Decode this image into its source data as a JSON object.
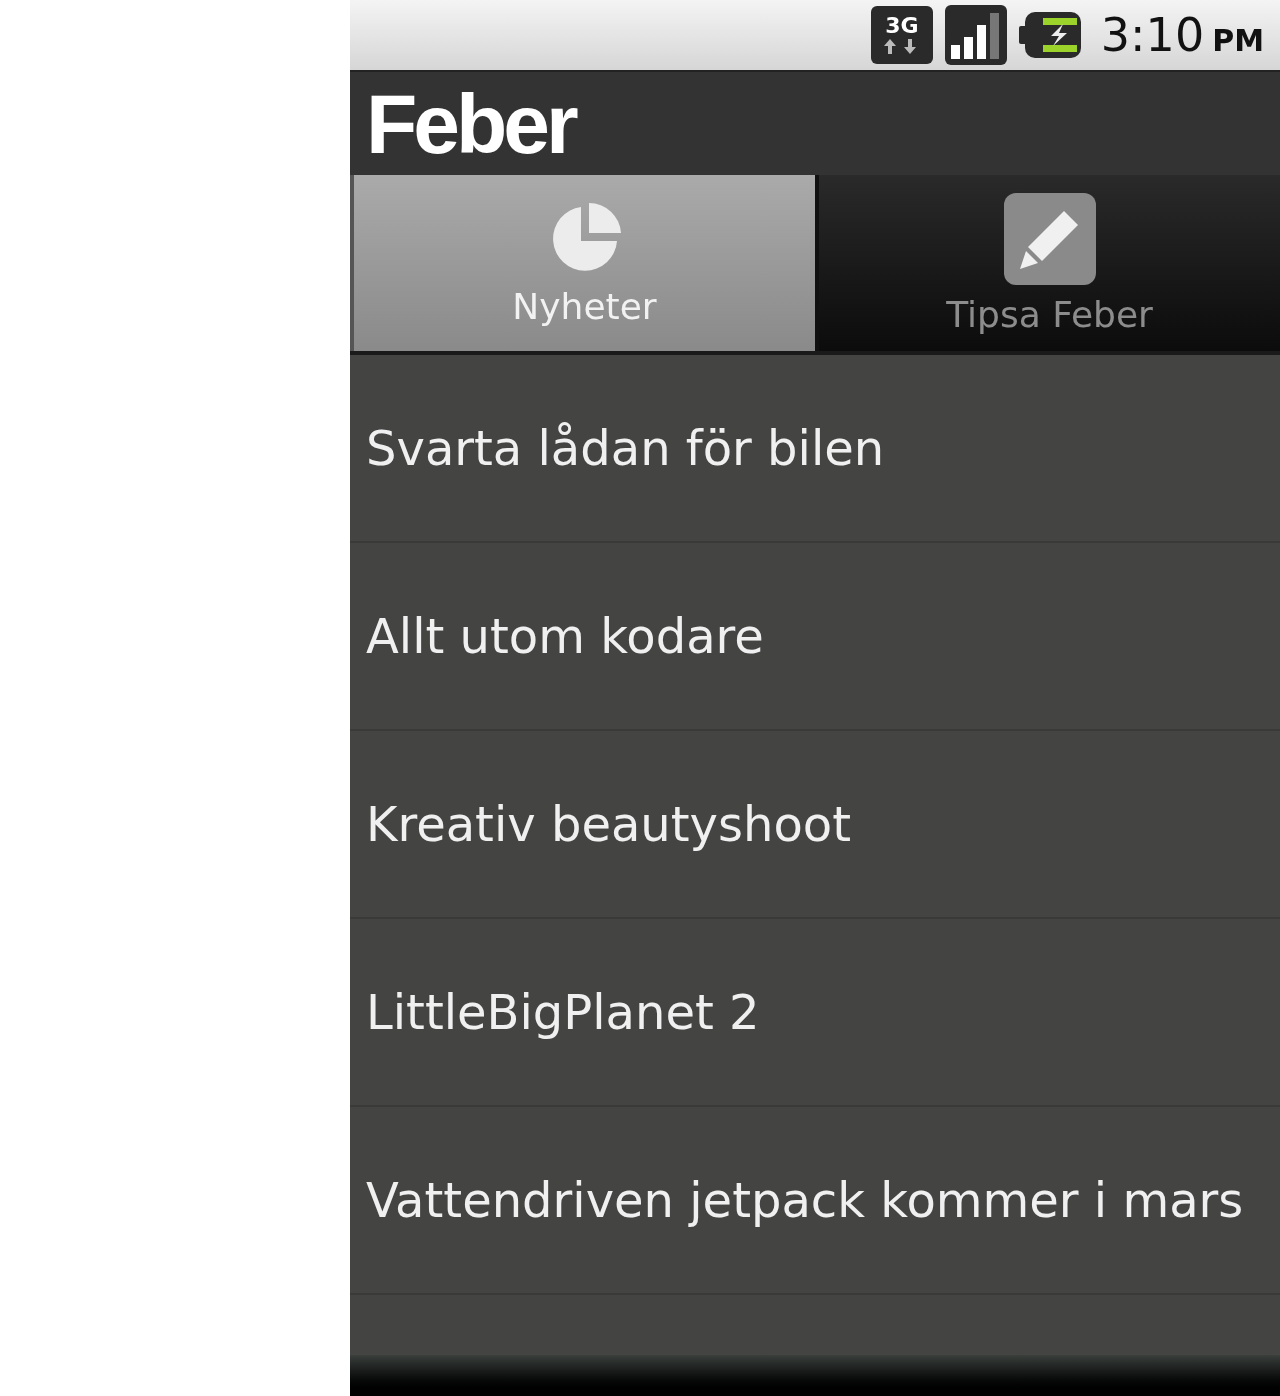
{
  "status_bar": {
    "network": "3G",
    "time": "3:10",
    "period": "PM"
  },
  "app_bar": {
    "logo": "Feber"
  },
  "tabs": [
    {
      "label": "Nyheter",
      "selected": true
    },
    {
      "label": "Tipsa Feber",
      "selected": false
    }
  ],
  "articles": [
    "Svarta lådan för bilen",
    "Allt utom kodare",
    "Kreativ beautyshoot",
    "LittleBigPlanet 2",
    "Vattendriven jetpack kommer i mars"
  ]
}
